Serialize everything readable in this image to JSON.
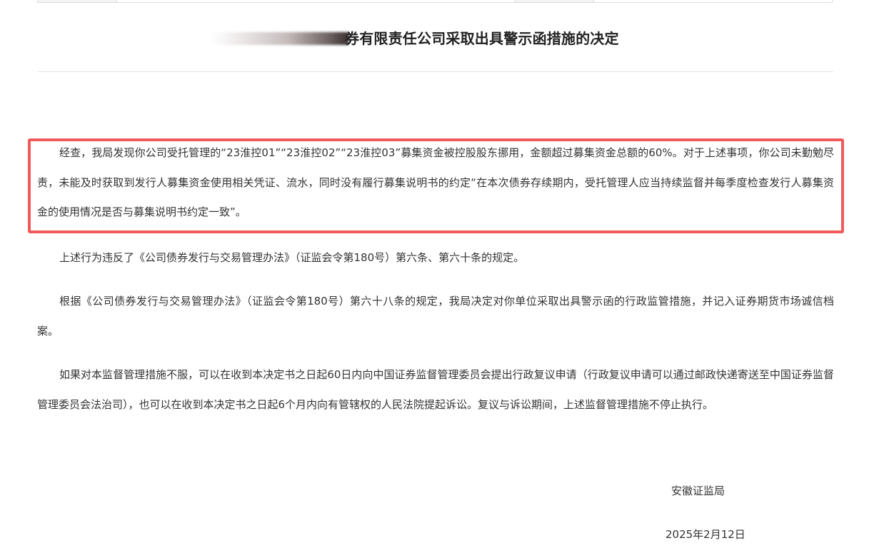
{
  "document": {
    "title": "券有限责任公司采取出具警示函措施的决定",
    "paragraphs": [
      "经查，我局发现你公司受托管理的“23淮控01”“23淮控02”“23淮控03”募集资金被控股股东挪用，金额超过募集资金总额的60%。对于上述事项，你公司未勤勉尽责，未能及时获取到发行人募集资金使用相关凭证、流水，同时没有履行募集说明书的约定“在本次债券存续期内，受托管理人应当持续监督并每季度检查发行人募集资金的使用情况是否与募集说明书约定一致”。",
      "上述行为违反了《公司债券发行与交易管理办法》（证监会令第180号）第六条、第六十条的规定。",
      "根据《公司债券发行与交易管理办法》（证监会令第180号）第六十八条的规定，我局决定对你单位采取出具警示函的行政监管措施，并记入证券期货市场诚信档案。",
      "如果对本监督管理措施不服，可以在收到本决定书之日起60日内向中国证券监督管理委员会提出行政复议申请（行政复议申请可以通过邮政快递寄送至中国证券监督管理委员会法治司），也可以在收到本决定书之日起6个月内向有管辖权的人民法院提起诉讼。复议与诉讼期间，上述监督管理措施不停止执行。"
    ],
    "signature": {
      "organization": "安徽证监局",
      "date": "2025年2月12日"
    }
  },
  "colors": {
    "highlight_border": "#f05a5a",
    "text": "#333333",
    "rule": "#e3e3e3"
  }
}
